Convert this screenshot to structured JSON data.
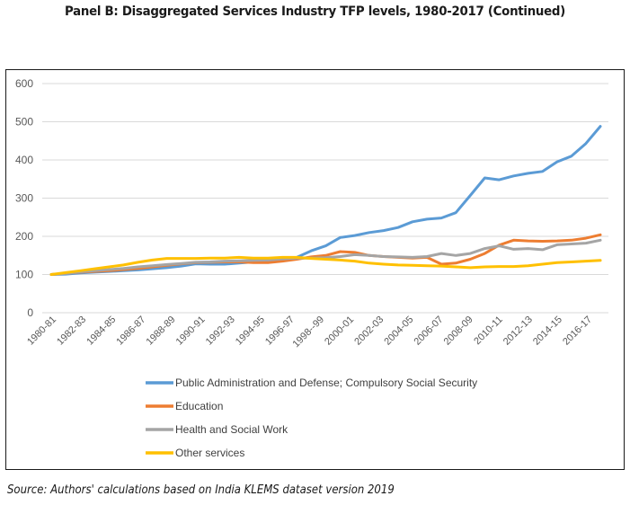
{
  "title": "Panel B: Disaggregated Services Industry TFP levels, 1980-2017 (Continued)",
  "source": "Source: Authors' calculations based on India KLEMS dataset version 2019",
  "chart_data": {
    "type": "line",
    "title": "Panel B: Disaggregated Services Industry TFP levels, 1980-2017 (Continued)",
    "xlabel": "",
    "ylabel": "",
    "ylim": [
      0,
      600
    ],
    "yticks": [
      0,
      100,
      200,
      300,
      400,
      500,
      600
    ],
    "grid": true,
    "legend_position": "bottom",
    "x": [
      "1980-81",
      "1981-82",
      "1982-83",
      "1983-84",
      "1984-85",
      "1985-86",
      "1986-87",
      "1987-88",
      "1988-89",
      "1989-90",
      "1990-91",
      "1991-92",
      "1992-93",
      "1993-94",
      "1994-95",
      "1995-96",
      "1996-97",
      "1997-98",
      "1998--99",
      "1999-00",
      "2000-01",
      "2001-02",
      "2002-03",
      "2003-04",
      "2004-05",
      "2005-06",
      "2006-07",
      "2007-08",
      "2008-09",
      "2009-10",
      "2010-11",
      "2011-12",
      "2012-13",
      "2013-14",
      "2014-15",
      "2015-16",
      "2016-17"
    ],
    "xtick_labels": [
      "1980-81",
      "1982-83",
      "1984-85",
      "1986-87",
      "1988-89",
      "1990-91",
      "1992-93",
      "1994-95",
      "1996-97",
      "1998--99",
      "2000-01",
      "2002-03",
      "2004-05",
      "2006-07",
      "2008-09",
      "2010-11",
      "2012-13",
      "2014-15",
      "2016-17"
    ],
    "series": [
      {
        "name": "Public Administration and Defense; Compulsory Social Security",
        "color": "#5B9BD5",
        "values": [
          100,
          101,
          104,
          106,
          108,
          110,
          112,
          115,
          118,
          122,
          128,
          127,
          127,
          130,
          133,
          135,
          140,
          145,
          162,
          175,
          197,
          202,
          210,
          215,
          223,
          238,
          245,
          248,
          262,
          307,
          353,
          348,
          358,
          365,
          370,
          395,
          410,
          443,
          488
        ]
      },
      {
        "name": "Education",
        "color": "#ED7D31",
        "values": [
          100,
          103,
          106,
          108,
          110,
          113,
          116,
          120,
          124,
          128,
          131,
          132,
          133,
          133,
          131,
          131,
          135,
          140,
          146,
          150,
          160,
          158,
          150,
          147,
          145,
          143,
          145,
          127,
          130,
          140,
          155,
          177,
          190,
          188,
          187,
          188,
          190,
          195,
          204
        ]
      },
      {
        "name": "Health and Social Work",
        "color": "#A5A5A5",
        "values": [
          100,
          103,
          107,
          110,
          113,
          116,
          120,
          123,
          126,
          129,
          132,
          133,
          135,
          136,
          137,
          138,
          141,
          143,
          143,
          144,
          147,
          152,
          150,
          147,
          146,
          145,
          147,
          155,
          150,
          155,
          168,
          175,
          166,
          168,
          165,
          178,
          180,
          182,
          190
        ]
      },
      {
        "name": "Other services",
        "color": "#FFC000",
        "values": [
          100,
          105,
          110,
          115,
          120,
          125,
          132,
          138,
          142,
          142,
          142,
          143,
          143,
          145,
          143,
          143,
          145,
          145,
          142,
          140,
          138,
          135,
          130,
          127,
          125,
          124,
          123,
          122,
          120,
          118,
          120,
          121,
          121,
          123,
          127,
          131,
          133,
          135,
          137
        ]
      }
    ]
  }
}
